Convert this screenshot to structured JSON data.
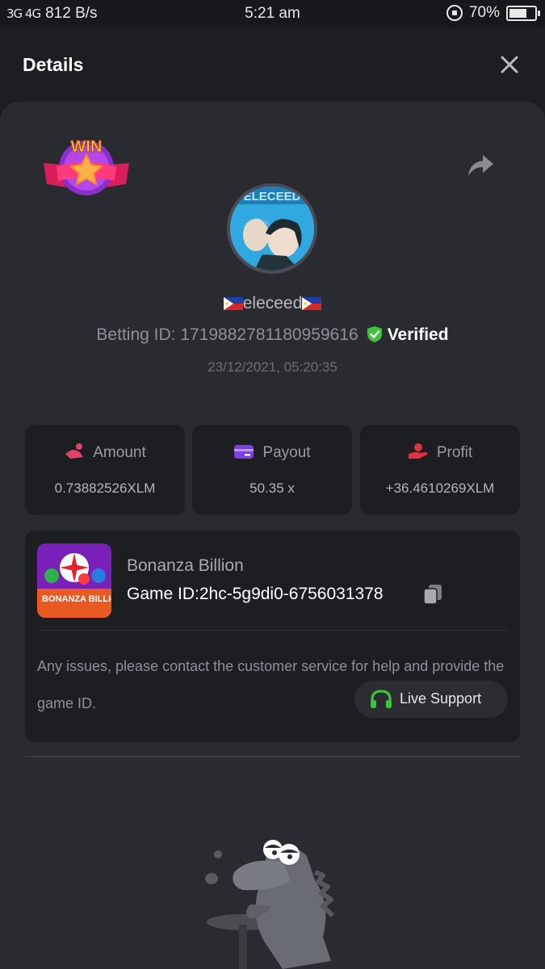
{
  "status_bar": {
    "network": "3G 4G",
    "speed": "812 B/s",
    "time": "5:21 am",
    "battery": "70%",
    "battery_level": 0.7
  },
  "header": {
    "title": "Details"
  },
  "user": {
    "name": "eleceed",
    "avatar_text": "ELECEED",
    "betting_id_label": "Betting ID:",
    "betting_id": "1719882781180959616",
    "verified_label": "Verified",
    "date": "23/12/2021, 05:20:35"
  },
  "win_badge": {
    "text": "WIN"
  },
  "stats": [
    {
      "label": "Amount",
      "value": "0.73882526XLM",
      "icon": "bet-coin-icon",
      "color": "#e0446b"
    },
    {
      "label": "Payout",
      "value": "50.35 x",
      "icon": "card-icon",
      "color": "#7b3fe4"
    },
    {
      "label": "Profit",
      "value": "+36.4610269XLM",
      "icon": "hand-money-icon",
      "color": "#e0333d"
    }
  ],
  "game": {
    "name": "Bonanza Billion",
    "thumb_text": "BONANZA BILLION",
    "id_label": "Game ID:",
    "id": "2hc-5g9di0-6756031378",
    "issue_text": "Any issues, please contact the customer service for help and provide the game ID.",
    "support_label": "Live Support",
    "support_color": "#3ec43a"
  },
  "colors": {
    "background": "#1d1e22",
    "card": "#2a2b30",
    "verified": "#3ec43a"
  }
}
